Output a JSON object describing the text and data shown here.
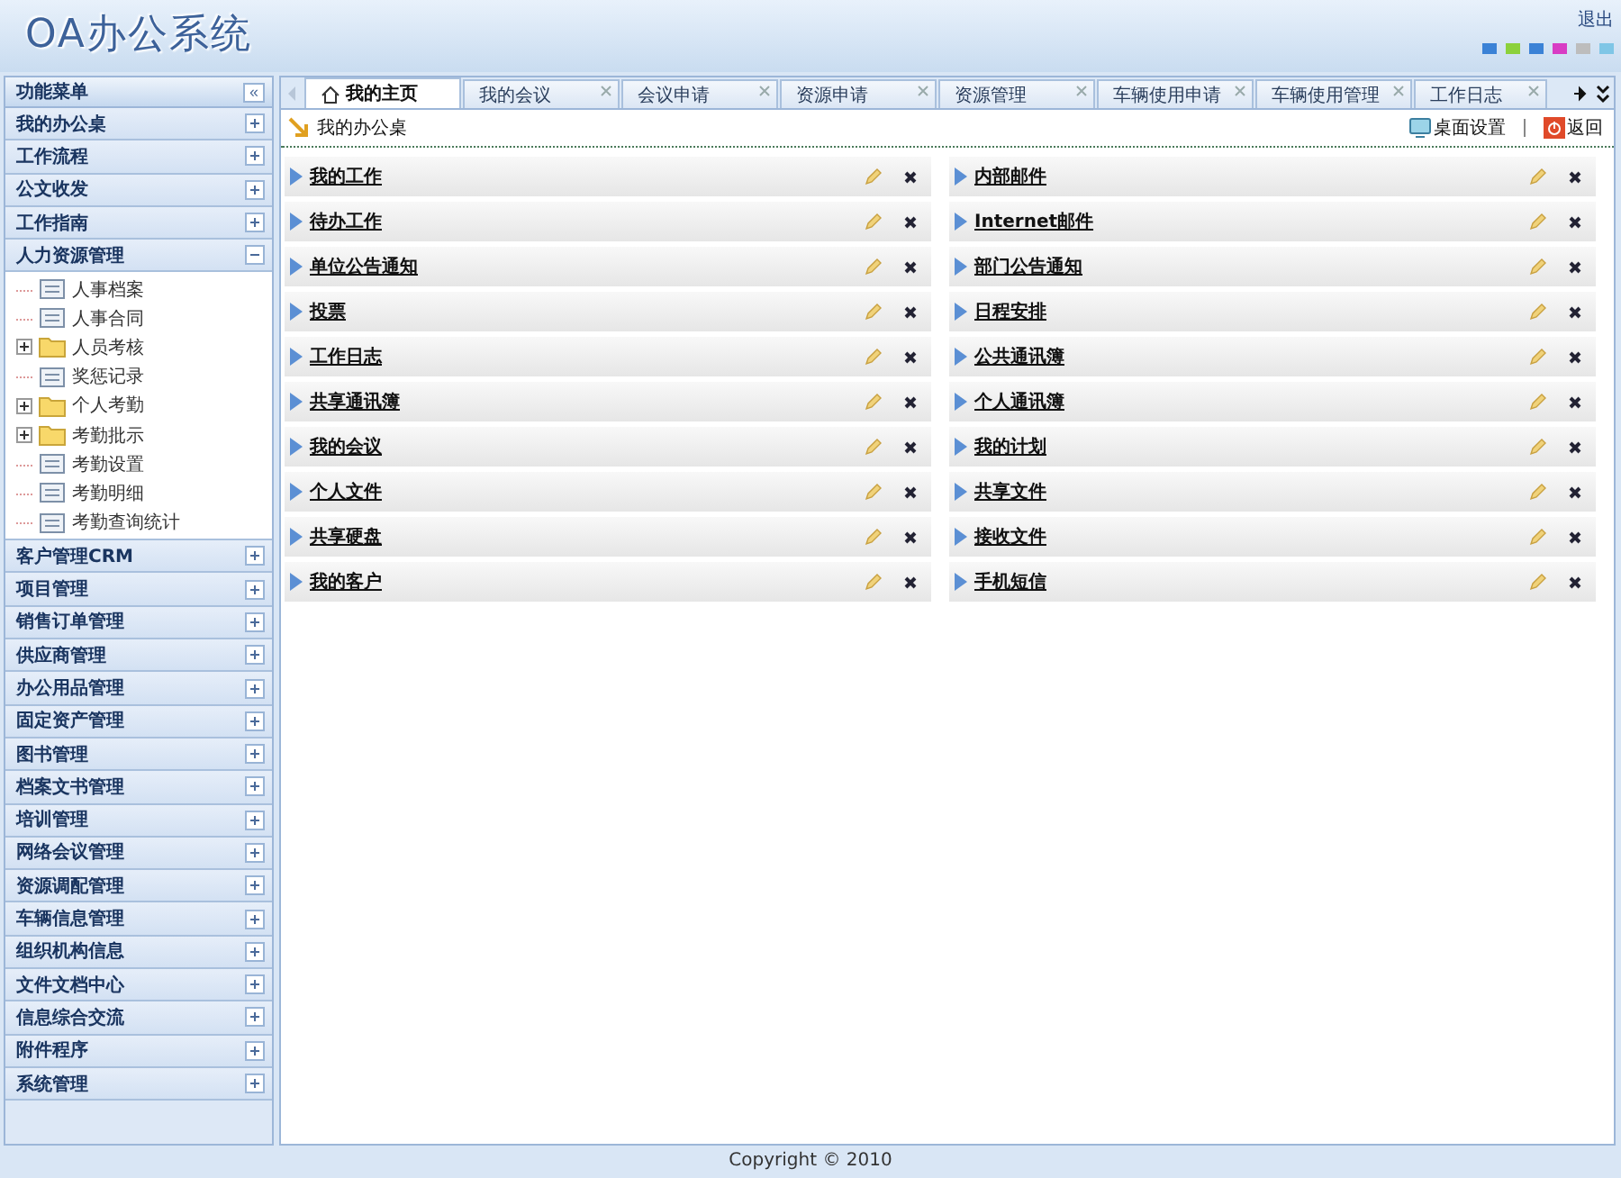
{
  "header": {
    "logo": "OA办公系统",
    "logout": "退出",
    "themes": [
      {
        "color": "#3b82d6"
      },
      {
        "color": "#8cd13c"
      },
      {
        "color": "#3b82d6"
      },
      {
        "color": "#d83cc4"
      },
      {
        "color": "#bdbdbd"
      },
      {
        "color": "#7fc6e6"
      }
    ]
  },
  "sidebar": {
    "title": "功能菜单",
    "collapse_button": "«",
    "groups": [
      {
        "label": "我的办公桌",
        "expanded": false
      },
      {
        "label": "工作流程",
        "expanded": false
      },
      {
        "label": "公文收发",
        "expanded": false
      },
      {
        "label": "工作指南",
        "expanded": false
      },
      {
        "label": "人力资源管理",
        "expanded": true,
        "children": [
          {
            "label": "人事档案",
            "kind": "page"
          },
          {
            "label": "人事合同",
            "kind": "page"
          },
          {
            "label": "人员考核",
            "kind": "folder",
            "expanded": false
          },
          {
            "label": "奖惩记录",
            "kind": "page"
          },
          {
            "label": "个人考勤",
            "kind": "folder",
            "expanded": false
          },
          {
            "label": "考勤批示",
            "kind": "folder",
            "expanded": false
          },
          {
            "label": "考勤设置",
            "kind": "page"
          },
          {
            "label": "考勤明细",
            "kind": "page"
          },
          {
            "label": "考勤查询统计",
            "kind": "page"
          }
        ]
      },
      {
        "label": "客户管理CRM",
        "expanded": false
      },
      {
        "label": "项目管理",
        "expanded": false
      },
      {
        "label": "销售订单管理",
        "expanded": false
      },
      {
        "label": "供应商管理",
        "expanded": false
      },
      {
        "label": "办公用品管理",
        "expanded": false
      },
      {
        "label": "固定资产管理",
        "expanded": false
      },
      {
        "label": "图书管理",
        "expanded": false
      },
      {
        "label": "档案文书管理",
        "expanded": false
      },
      {
        "label": "培训管理",
        "expanded": false
      },
      {
        "label": "网络会议管理",
        "expanded": false
      },
      {
        "label": "资源调配管理",
        "expanded": false
      },
      {
        "label": "车辆信息管理",
        "expanded": false
      },
      {
        "label": "组织机构信息",
        "expanded": false
      },
      {
        "label": "文件文档中心",
        "expanded": false
      },
      {
        "label": "信息综合交流",
        "expanded": false
      },
      {
        "label": "附件程序",
        "expanded": false
      },
      {
        "label": "系统管理",
        "expanded": false
      }
    ]
  },
  "tabs": [
    {
      "label": "我的主页",
      "selected": true,
      "closable": false
    },
    {
      "label": "我的会议",
      "selected": false,
      "closable": true
    },
    {
      "label": "会议申请",
      "selected": false,
      "closable": true
    },
    {
      "label": "资源申请",
      "selected": false,
      "closable": true
    },
    {
      "label": "资源管理",
      "selected": false,
      "closable": true
    },
    {
      "label": "车辆使用申请",
      "selected": false,
      "closable": true
    },
    {
      "label": "车辆使用管理",
      "selected": false,
      "closable": true
    },
    {
      "label": "工作日志",
      "selected": false,
      "closable": true
    }
  ],
  "toolbar": {
    "breadcrumb": "我的办公桌",
    "desktop_settings": "桌面设置",
    "back": "返回"
  },
  "portlets": [
    [
      "我的工作",
      "待办工作",
      "单位公告通知",
      "投票",
      "工作日志",
      "共享通讯簿",
      "我的会议",
      "个人文件",
      "共享硬盘",
      "我的客户"
    ],
    [
      "内部邮件",
      "Internet邮件",
      "部门公告通知",
      "日程安排",
      "公共通讯簿",
      "个人通讯簿",
      "我的计划",
      "共享文件",
      "接收文件",
      "手机短信"
    ]
  ],
  "footer": "Copyright © 2010"
}
